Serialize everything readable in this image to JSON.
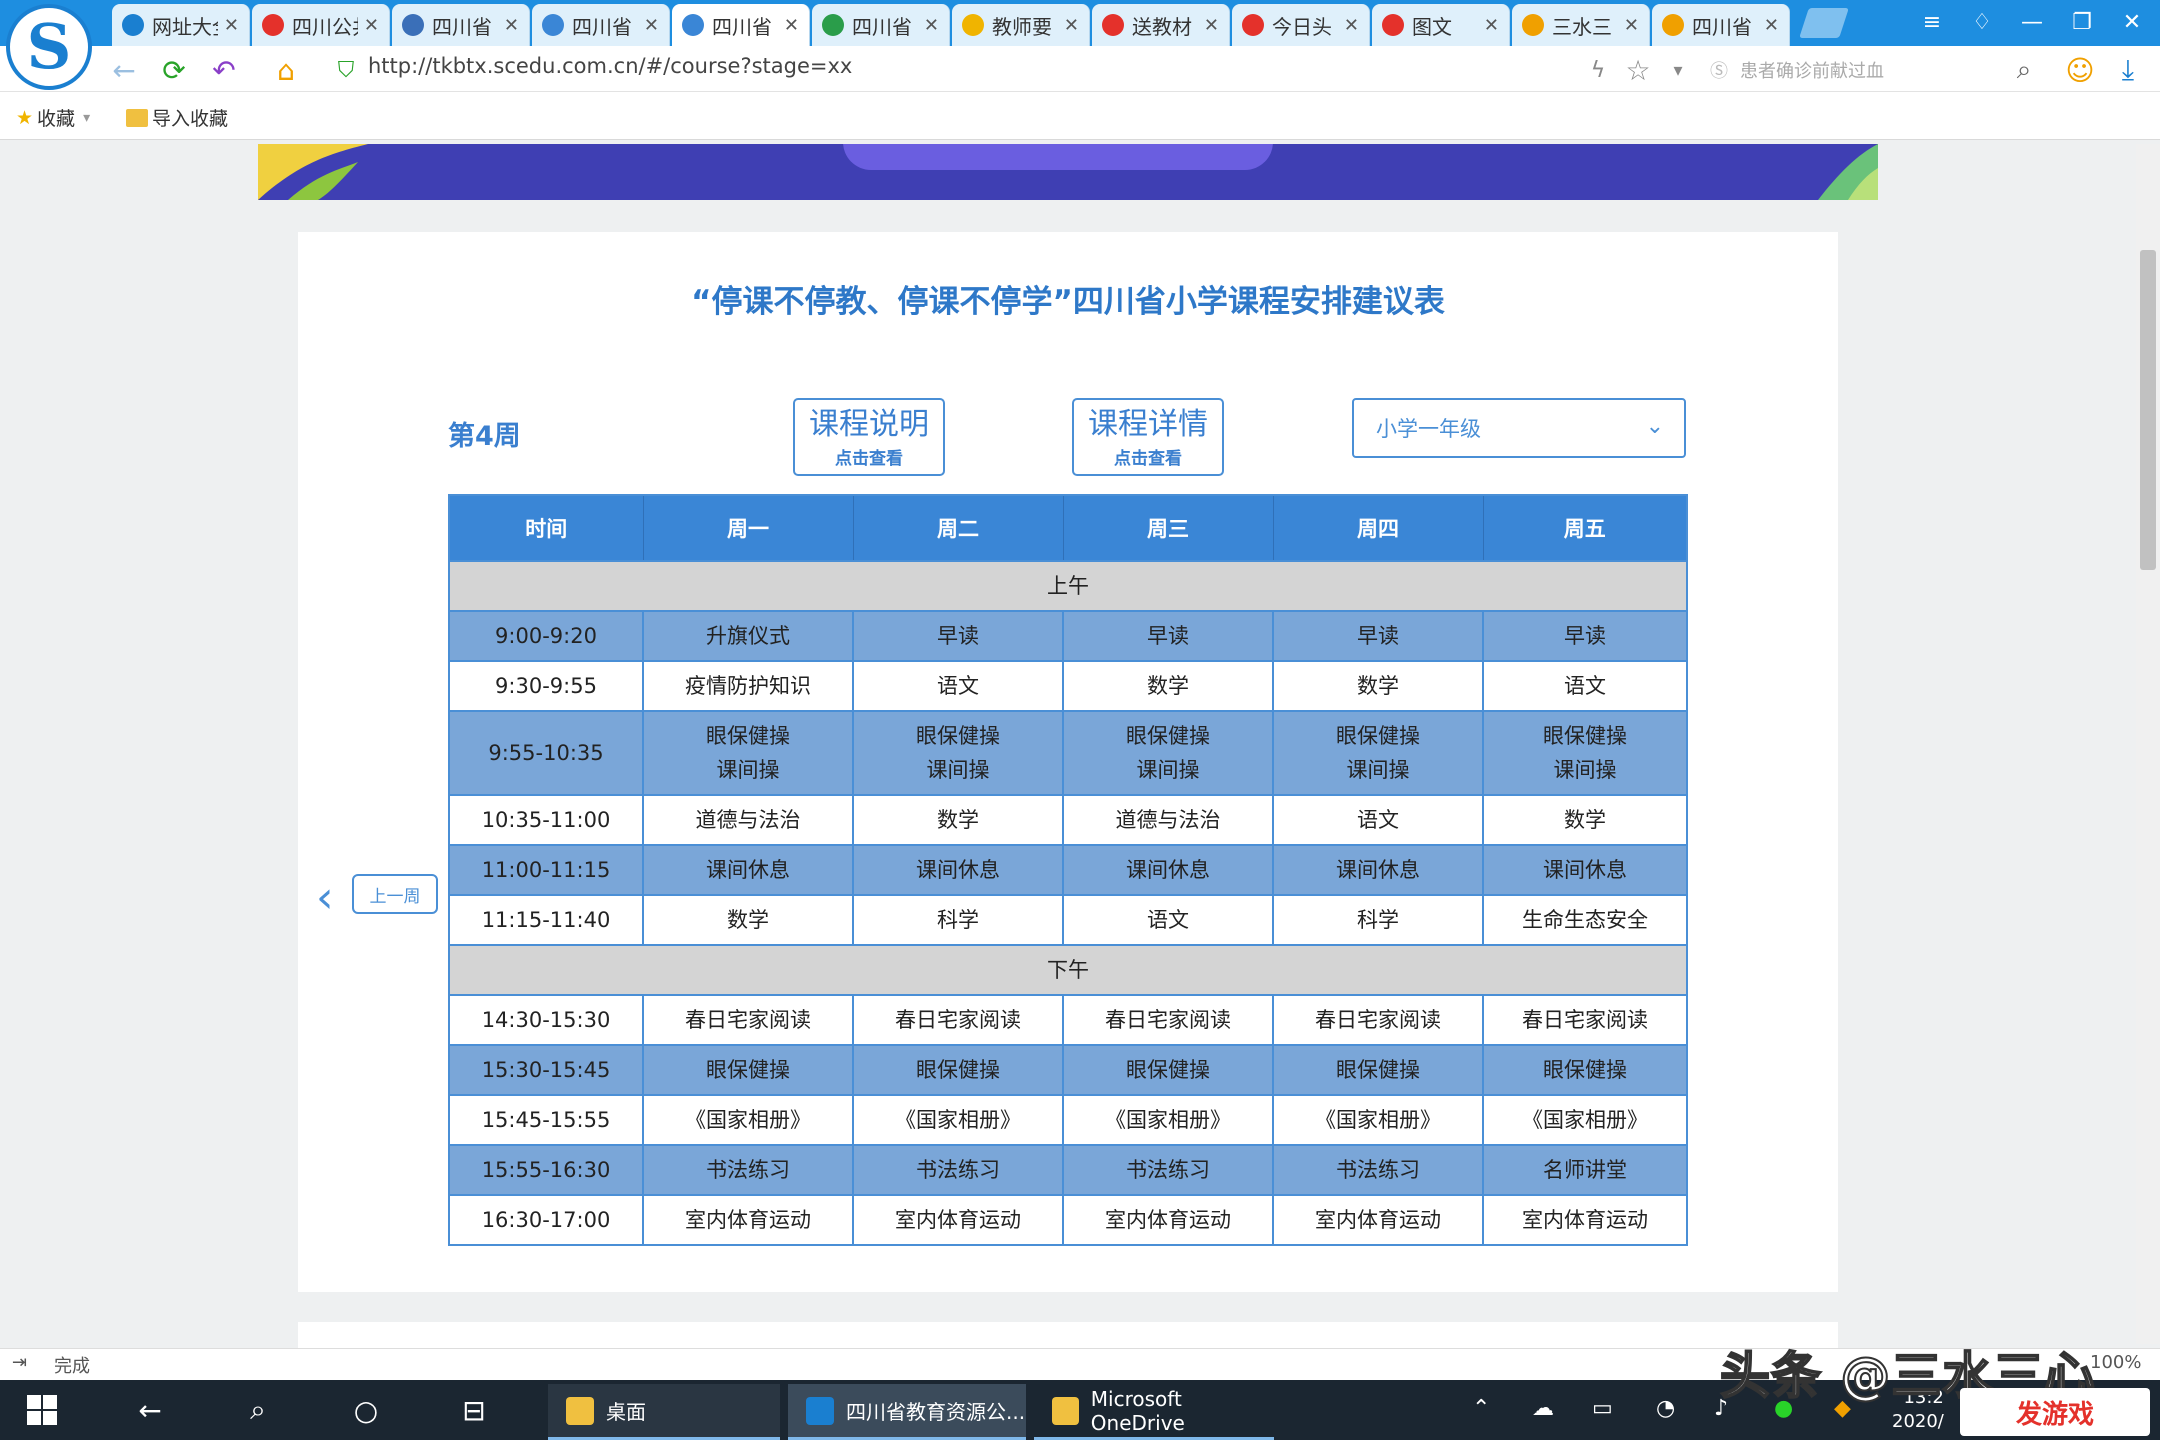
{
  "browser": {
    "tabs": [
      {
        "label": "网址大全",
        "color": "#1a7fd0"
      },
      {
        "label": "四川公共",
        "color": "#e4312b"
      },
      {
        "label": "四川省",
        "color": "#3a6fb8"
      },
      {
        "label": "四川省",
        "color": "#3a86d6"
      },
      {
        "label": "四川省",
        "color": "#3a86d6"
      },
      {
        "label": "四川省",
        "color": "#2a9d4a"
      },
      {
        "label": "教师要",
        "color": "#f0b400"
      },
      {
        "label": "送教材",
        "color": "#e4312b"
      },
      {
        "label": "今日头",
        "color": "#e4312b"
      },
      {
        "label": "图文",
        "color": "#e4312b"
      },
      {
        "label": "三水三",
        "color": "#f0a000"
      },
      {
        "label": "四川省",
        "color": "#f0a000"
      }
    ],
    "active_tab_index": 4,
    "close_glyph": "✕",
    "url": "http://tkbtx.scedu.com.cn/#/course?stage=xx",
    "search_placeholder": "患者确诊前献过血",
    "bookmarks": {
      "favorites": "收藏",
      "import": "导入收藏"
    }
  },
  "page": {
    "title": "“停课不停教、停课不停学”四川省小学课程安排建议表",
    "week": "第4周",
    "btn_course_desc": {
      "main": "课程说明",
      "sub": "点击查看"
    },
    "btn_course_detail": {
      "main": "课程详情",
      "sub": "点击查看"
    },
    "grade_select": "小学一年级",
    "prev_week": "上一周"
  },
  "schedule": {
    "headers": [
      "时间",
      "周一",
      "周二",
      "周三",
      "周四",
      "周五"
    ],
    "morning_label": "上午",
    "afternoon_label": "下午",
    "morning": [
      {
        "time": "9:00-9:20",
        "cells": [
          "升旗仪式",
          "早读",
          "早读",
          "早读",
          "早读"
        ],
        "style": "blue"
      },
      {
        "time": "9:30-9:55",
        "cells": [
          "疫情防护知识",
          "语文",
          "数学",
          "数学",
          "语文"
        ],
        "style": "white"
      },
      {
        "time": "9:55-10:35",
        "cells": [
          "眼保健操\n课间操",
          "眼保健操\n课间操",
          "眼保健操\n课间操",
          "眼保健操\n课间操",
          "眼保健操\n课间操"
        ],
        "style": "blue"
      },
      {
        "time": "10:35-11:00",
        "cells": [
          "道德与法治",
          "数学",
          "道德与法治",
          "语文",
          "数学"
        ],
        "style": "white"
      },
      {
        "time": "11:00-11:15",
        "cells": [
          "课间休息",
          "课间休息",
          "课间休息",
          "课间休息",
          "课间休息"
        ],
        "style": "blue"
      },
      {
        "time": "11:15-11:40",
        "cells": [
          "数学",
          "科学",
          "语文",
          "科学",
          "生命生态安全"
        ],
        "style": "white"
      }
    ],
    "afternoon": [
      {
        "time": "14:30-15:30",
        "cells": [
          "春日宅家阅读",
          "春日宅家阅读",
          "春日宅家阅读",
          "春日宅家阅读",
          "春日宅家阅读"
        ],
        "style": "white"
      },
      {
        "time": "15:30-15:45",
        "cells": [
          "眼保健操",
          "眼保健操",
          "眼保健操",
          "眼保健操",
          "眼保健操"
        ],
        "style": "blue"
      },
      {
        "time": "15:45-15:55",
        "cells": [
          "《国家相册》",
          "《国家相册》",
          "《国家相册》",
          "《国家相册》",
          "《国家相册》"
        ],
        "style": "white"
      },
      {
        "time": "15:55-16:30",
        "cells": [
          "书法练习",
          "书法练习",
          "书法练习",
          "书法练习",
          "名师讲堂"
        ],
        "style": "blue"
      },
      {
        "time": "16:30-17:00",
        "cells": [
          "室内体育运动",
          "室内体育运动",
          "室内体育运动",
          "室内体育运动",
          "室内体育运动"
        ],
        "style": "white"
      }
    ]
  },
  "statusbar": {
    "text": "完成",
    "zoom": "100%"
  },
  "taskbar": {
    "apps": [
      {
        "label": "桌面",
        "color": "#f0c040"
      },
      {
        "label": "四川省教育资源公...",
        "color": "#1a7fd0"
      },
      {
        "label": "Microsoft OneDrive",
        "color": "#f0c040"
      }
    ],
    "time": "13:2",
    "date": "2020/"
  },
  "watermark": {
    "text": "头条 @三水三心",
    "site": "发游戏"
  },
  "colors": {
    "accent": "#3a86d6",
    "tabbar": "#1e8ee0",
    "row_blue": "#7aa6d8",
    "section_gray": "#d4d4d4"
  }
}
